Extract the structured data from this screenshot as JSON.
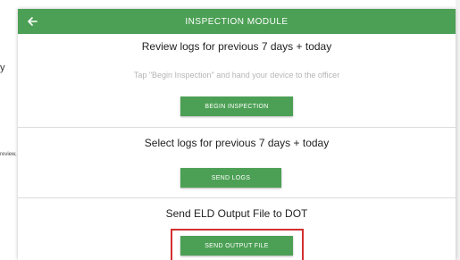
{
  "modal": {
    "title": "INSPECTION MODULE",
    "back_icon": "arrow-left-icon",
    "sections": {
      "review": {
        "title": "Review logs for previous 7 days + today",
        "instruction": "Tap \"Begin Inspection\" and hand your device to the officer",
        "button_label": "BEGIN INSPECTION"
      },
      "select": {
        "title": "Select logs for previous 7 days + today",
        "button_label": "SEND LOGS"
      },
      "output": {
        "title": "Send ELD Output File to DOT",
        "button_label": "SEND OUTPUT FILE"
      }
    }
  },
  "background": {
    "fragment_y": "y",
    "fragment_review": "review, yo"
  },
  "colors": {
    "header_green": "#4ca055",
    "button_green": "#4ca055",
    "highlight_red": "#d32f2f",
    "instruction_gray": "#b5b5b5"
  }
}
